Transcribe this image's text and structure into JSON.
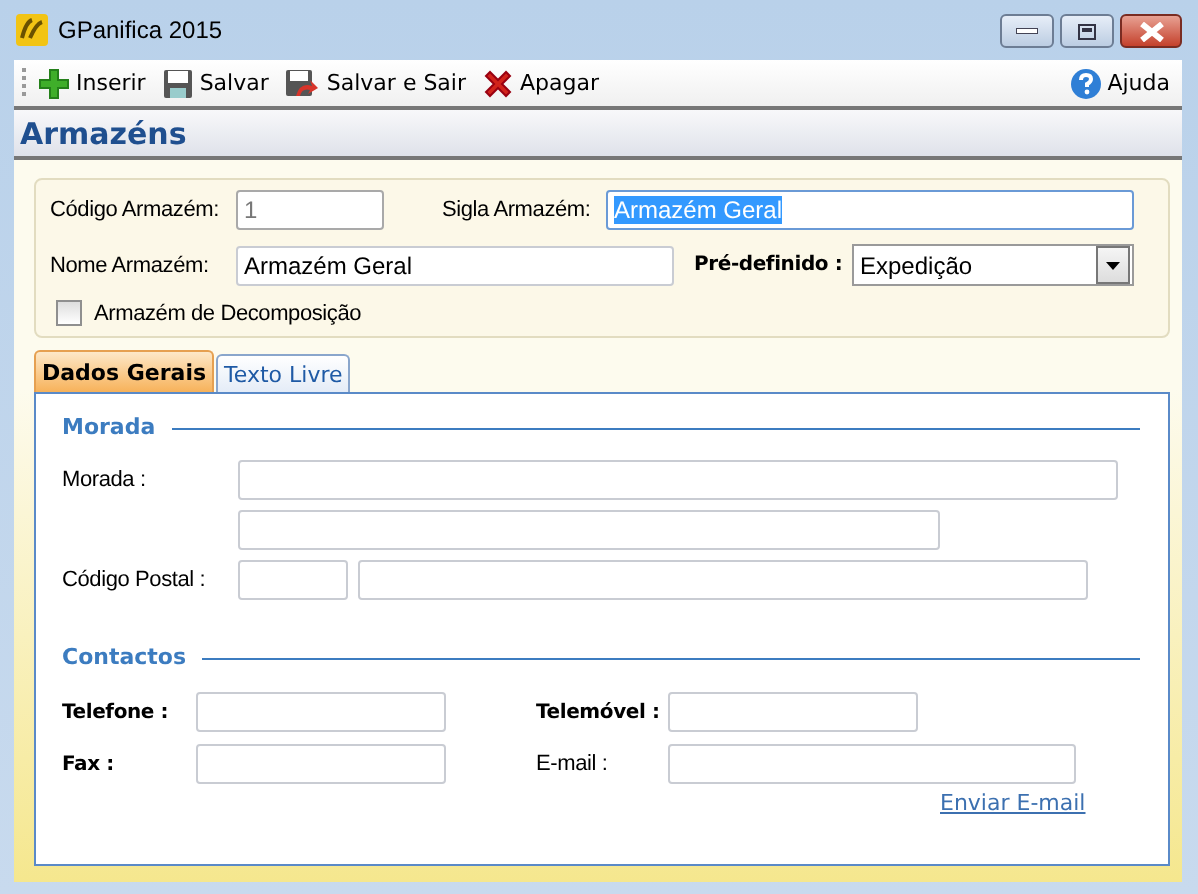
{
  "window": {
    "title": "GPanifica 2015"
  },
  "toolbar": {
    "buttons": [
      {
        "label": "Inserir",
        "kind": "add"
      },
      {
        "label": "Salvar",
        "kind": "save"
      },
      {
        "label": "Salvar e Sair",
        "kind": "save-exit"
      },
      {
        "label": "Apagar",
        "kind": "delete"
      }
    ],
    "help": {
      "label": "Ajuda"
    }
  },
  "page_title": "Armazéns",
  "header_form": {
    "codigo": {
      "label": "Código Armazém:",
      "value": "1",
      "disabled": true
    },
    "sigla": {
      "label": "Sigla Armazém:",
      "value": "Armazém Geral",
      "text_selected": true
    },
    "nome": {
      "label": "Nome Armazém:",
      "value": "Armazém Geral"
    },
    "predefinido": {
      "label": "Pré-definido :",
      "value": "Expedição"
    },
    "decomposicao": {
      "label": "Armazém de Decomposição",
      "checked": false
    }
  },
  "tabs": [
    {
      "label": "Dados Gerais",
      "selected": true
    },
    {
      "label": "Texto Livre",
      "selected": false
    }
  ],
  "morada": {
    "title": "Morada",
    "address_label": "Morada :",
    "postal_label": "Código Postal :"
  },
  "contactos": {
    "title": "Contactos",
    "telefone_label": "Telefone :",
    "telemovel_label": "Telemóvel :",
    "fax_label": "Fax :",
    "email_label": "E-mail :",
    "send_link": "Enviar E-mail"
  }
}
